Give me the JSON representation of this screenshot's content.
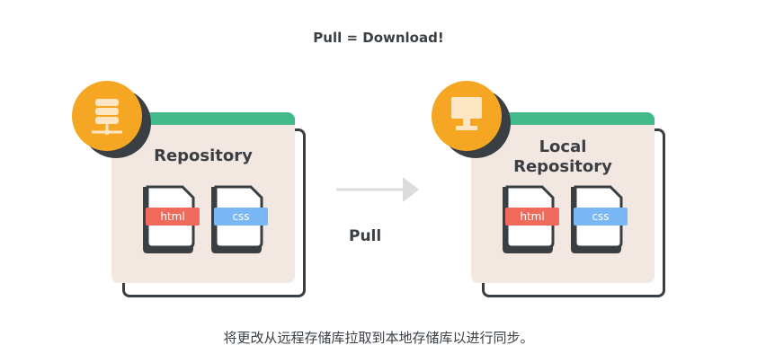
{
  "diagram": {
    "title": "Pull = Download!",
    "action_label": "Pull",
    "caption": "将更改从远程存储库拉取到本地存储库以进行同步。",
    "remote": {
      "title_line1": "Repository",
      "title_line2": "",
      "files": [
        "html",
        "css"
      ],
      "icon": "server-icon"
    },
    "local": {
      "title_line1": "Local",
      "title_line2": "Repository",
      "files": [
        "html",
        "css"
      ],
      "icon": "monitor-icon"
    },
    "colors": {
      "accent_green": "#43b98a",
      "badge_orange": "#f5a623",
      "panel_bg": "#f3e7e2",
      "dark": "#3a3f44",
      "html_tag": "#ef6a5a",
      "css_tag": "#7ab8f5",
      "arrow": "#dcdcdc"
    }
  }
}
